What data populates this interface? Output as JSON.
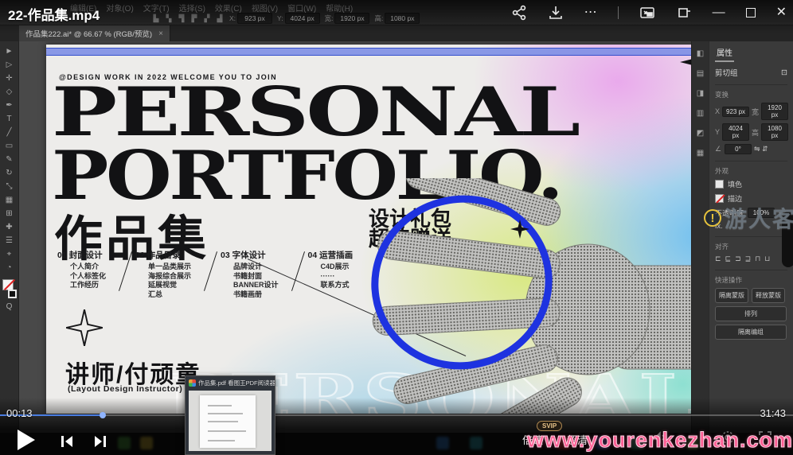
{
  "player": {
    "title": "22-作品集.mp4",
    "elapsed": "00:13",
    "duration": "31:43",
    "progress_percent": 13,
    "speed_label": "倍速",
    "quality_label": "超清",
    "badge": "SVIP",
    "more_icon": "⋯",
    "minimize_icon": "—",
    "close_icon": "✕",
    "watermark_url": "www.yourenkezhan.com",
    "accent_color": "#4a7de0",
    "watermark_color": "#ff5d93"
  },
  "site_watermark": {
    "text": "游人客栈",
    "icon": "!"
  },
  "popup": {
    "title": "作品集.pdf 看图王PDF阅读器"
  },
  "illustrator": {
    "menu": [
      "编辑(E)",
      "对象(O)",
      "文字(T)",
      "选择(S)",
      "效果(C)",
      "视图(V)",
      "窗口(W)",
      "帮助(H)"
    ],
    "doc_tab": "作品集222.ai* @ 66.67 % (RGB/预览)",
    "doc_tab_close": "×",
    "control_fields": {
      "x_label": "X:",
      "x": "923 px",
      "y_label": "Y:",
      "y": "4024 px",
      "w_label": "宽:",
      "w": "1920 px",
      "h_label": "高:",
      "h": "1080 px"
    },
    "ctrl_glyphs": [
      "▙",
      "▚",
      "▜",
      "▛",
      "▞",
      "▟"
    ],
    "tool_glyphs": [
      "►",
      "▷",
      "✛",
      "◇",
      "✒",
      "T",
      "╱",
      "▭",
      "✎",
      "↻",
      "⤡",
      "▦",
      "⊞",
      "✚",
      "☰",
      "⌖",
      "◔",
      "Q"
    ],
    "dock_glyphs": [
      "◧",
      "▤",
      "◨",
      "▥",
      "◩",
      "▦"
    ],
    "properties": {
      "tab": "属性",
      "selection": "剪切组",
      "selection_icon": "⊡",
      "transform_label": "变换",
      "x_label": "X",
      "x": "923 px",
      "y_label": "Y",
      "y": "4024 px",
      "w_label": "宽",
      "w": "1920 px",
      "h_label": "高",
      "h": "1080 px",
      "angle_label": "∠",
      "angle": "0°",
      "flip_glyphs": "⇋ ⇵",
      "appearance_label": "外观",
      "fill_label": "填色",
      "stroke_label": "描边",
      "opacity_label": "不透明度",
      "opacity": "100%",
      "fx_label": "fx.",
      "align_label": "对齐",
      "align_glyphs": [
        "⊏",
        "⊑",
        "⊐",
        "⊒",
        "⊓",
        "⊔"
      ],
      "quick_label": "快速操作",
      "actions": [
        "隔离蒙版",
        "释放蒙版",
        "排列",
        "隔离编组"
      ]
    }
  },
  "poster": {
    "tagline": "@DESIGN WORK IN 2022 WELCOME YOU TO JOIN",
    "title_line1": "PERSONAL",
    "title_line2": "PORTFOLIO.",
    "cn_title": "作品集",
    "gift_line1": "设计礼包",
    "gift_line2": "超值赠送",
    "columns": [
      {
        "num": "01",
        "title": "封面设计",
        "items": [
          "个人简介",
          "个人标签化",
          "工作经历"
        ]
      },
      {
        "num": "02",
        "title": "作品目录",
        "items": [
          "单一品类展示",
          "海报综合展示",
          "延展视觉",
          "汇总"
        ]
      },
      {
        "num": "03",
        "title": "字体设计",
        "items": [
          "品牌设计",
          "书籍封面",
          "BANNER设计",
          "书籍画册"
        ]
      },
      {
        "num": "04",
        "title": "运营插画",
        "items": [
          "C4D展示",
          "······",
          "联系方式"
        ]
      }
    ],
    "instructor": "讲师/付顽童",
    "instructor_en": "(Layout Design Instructor)",
    "ghost_text": "PERSONAL"
  }
}
